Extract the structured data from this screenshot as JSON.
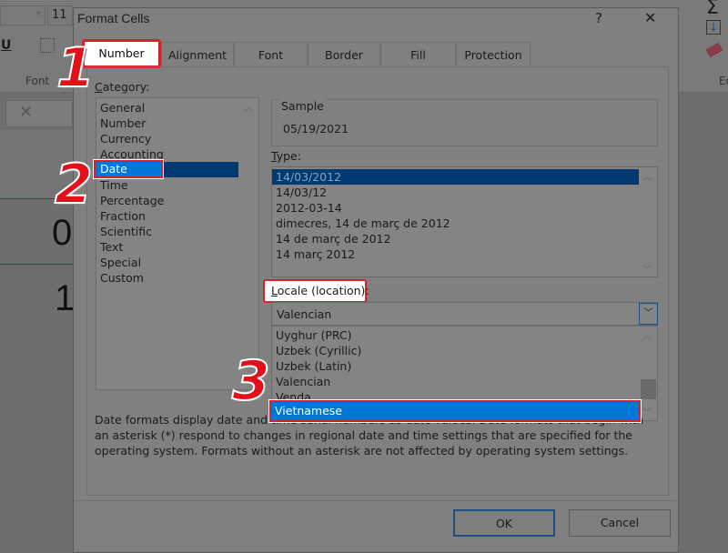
{
  "excel": {
    "font_size": "11",
    "font_group": "Font",
    "underline": "U",
    "editing_group": "Ed",
    "cell_values": [
      "0",
      "1"
    ],
    "sum_icon": "Σ"
  },
  "dialog": {
    "title": "Format Cells",
    "help": "?",
    "close": "✕",
    "tabs": [
      "Number",
      "Alignment",
      "Font",
      "Border",
      "Fill",
      "Protection"
    ],
    "category_label": "Category:",
    "categories": [
      "General",
      "Number",
      "Currency",
      "Accounting",
      "Date",
      "Time",
      "Percentage",
      "Fraction",
      "Scientific",
      "Text",
      "Special",
      "Custom"
    ],
    "selected_category": "Date",
    "sample_label": "Sample",
    "sample_value": "05/19/2021",
    "type_label": "Type:",
    "types": [
      "14/03/2012",
      "14/03/12",
      "2012-03-14",
      "dimecres, 14 de març de 2012",
      "14 de març de 2012",
      "14 març 2012"
    ],
    "locale_label": "Locale (location):",
    "locale_value": "Valencian",
    "locale_options": [
      "Uyghur (PRC)",
      "Uzbek (Cyrillic)",
      "Uzbek (Latin)",
      "Valencian",
      "Venda",
      "Vietnamese"
    ],
    "locale_highlighted": "Vietnamese",
    "description": "Date formats display date and time serial numbers as date values. Date formats that begin with an asterisk (*) respond to changes in regional date and time settings that are specified for the operating system. Formats without an asterisk are not affected by operating system settings.",
    "ok": "OK",
    "cancel": "Cancel"
  },
  "annotations": [
    "1",
    "2",
    "3"
  ],
  "colors": {
    "annotation_red": "#e3101a",
    "selection_navy": "#003a70",
    "highlight_blue": "#0078d7"
  }
}
